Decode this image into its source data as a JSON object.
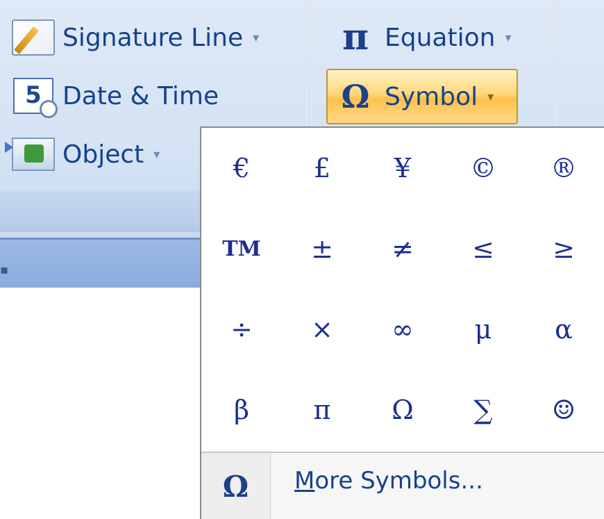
{
  "ribbon": {
    "commands": {
      "signature_line": "Signature Line",
      "date_time": "Date & Time",
      "object": "Object",
      "equation": "Equation",
      "symbol": "Symbol"
    },
    "icons": {
      "signature_line": "signature-pen-icon",
      "date_time": "calendar-clock-icon",
      "date_time_glyph": "5",
      "object": "insert-object-icon",
      "equation": "π",
      "symbol": "Ω"
    },
    "dropdown_arrow": "▾"
  },
  "symbol_gallery": {
    "symbols": [
      [
        "€",
        "£",
        "¥",
        "©",
        "®"
      ],
      [
        "TM",
        "±",
        "≠",
        "≤",
        "≥"
      ],
      [
        "÷",
        "×",
        "∞",
        "μ",
        "α"
      ],
      [
        "β",
        "π",
        "Ω",
        "∑",
        "☺"
      ]
    ],
    "footer": {
      "icon_glyph": "Ω",
      "more_symbols_mnemonic": "M",
      "more_symbols_rest": "ore Symbols..."
    }
  },
  "colors": {
    "ribbon_bg": "#dfe9f7",
    "accent_text": "#15428b",
    "symbol_button_highlight": "#ffc14a",
    "symbol_glyph": "#1b2f8f"
  }
}
